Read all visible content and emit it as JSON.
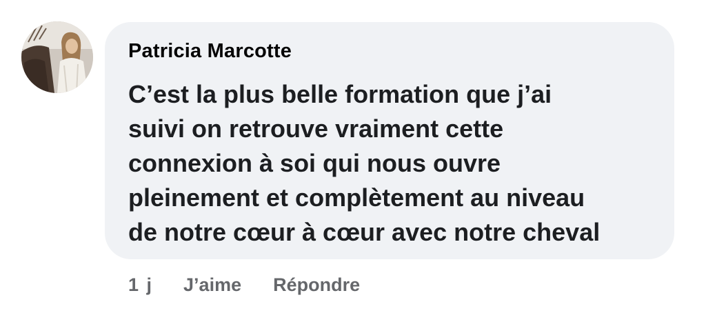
{
  "comment": {
    "author": "Patricia Marcotte",
    "lines": [
      "C’est la plus belle formation que j’ai",
      "suivi on retrouve vraiment cette",
      "connexion à soi qui nous ouvre",
      "pleinement et complètement au niveau",
      "de notre cœur à cœur avec notre cheval"
    ],
    "time": "1 j",
    "like_label": "J’aime",
    "reply_label": "Répondre"
  },
  "colors": {
    "bubble": "#f0f2f5",
    "meta_text": "#65676b",
    "body_text": "#1c1e21"
  }
}
